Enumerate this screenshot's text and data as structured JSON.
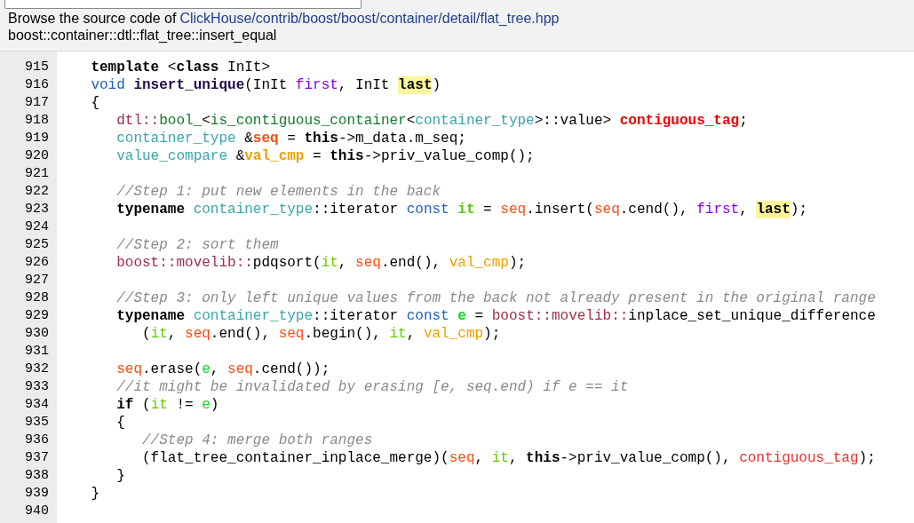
{
  "header": {
    "lead": "Browse the source code of",
    "path": [
      {
        "text": "ClickHouse"
      },
      {
        "text": "/"
      },
      {
        "text": "contrib"
      },
      {
        "text": "/"
      },
      {
        "text": "boost"
      },
      {
        "text": "/"
      },
      {
        "text": "boost"
      },
      {
        "text": "/"
      },
      {
        "text": "container"
      },
      {
        "text": "/"
      },
      {
        "text": "detail"
      },
      {
        "text": "/"
      },
      {
        "text": "flat_tree.hpp"
      }
    ],
    "symbol": "boost::container::dtl::flat_tree::insert_equal"
  },
  "lines": [
    {
      "number": "915",
      "tokens": [
        {
          "text": "    template",
          "kind": "keyword"
        },
        {
          "text": " <",
          "kind": "plain"
        },
        {
          "text": "class",
          "kind": "keyword"
        },
        {
          "text": " InIt>",
          "kind": "plain"
        }
      ]
    },
    {
      "number": "916",
      "tokens": [
        {
          "text": "    void",
          "kind": "type"
        },
        {
          "text": " insert_unique",
          "kind": "func"
        },
        {
          "text": "(InIt ",
          "kind": "plain"
        },
        {
          "text": "first",
          "kind": "param"
        },
        {
          "text": ", InIt ",
          "kind": "plain"
        },
        {
          "text": "last",
          "kind": "param-marked"
        },
        {
          "text": ")",
          "kind": "plain"
        }
      ]
    },
    {
      "number": "917",
      "tokens": [
        {
          "text": "    {",
          "kind": "plain"
        }
      ]
    },
    {
      "number": "918",
      "tokens": [
        {
          "text": "       dtl::",
          "kind": "ns"
        },
        {
          "text": "bool_",
          "kind": "tmpl"
        },
        {
          "text": "<",
          "kind": "plain"
        },
        {
          "text": "is_contiguous_container",
          "kind": "tmpl"
        },
        {
          "text": "<",
          "kind": "plain"
        },
        {
          "text": "container_type",
          "kind": "typedef"
        },
        {
          "text": ">::value> ",
          "kind": "plain"
        },
        {
          "text": "contiguous_tag",
          "kind": "tag"
        },
        {
          "text": ";",
          "kind": "plain"
        }
      ]
    },
    {
      "number": "919",
      "tokens": [
        {
          "text": "       container_type",
          "kind": "typedef"
        },
        {
          "text": " &",
          "kind": "plain"
        },
        {
          "text": "seq",
          "kind": "local-decl"
        },
        {
          "text": " = ",
          "kind": "plain"
        },
        {
          "text": "this",
          "kind": "keyword"
        },
        {
          "text": "->m_data.m_seq;",
          "kind": "plain"
        }
      ]
    },
    {
      "number": "920",
      "tokens": [
        {
          "text": "       value_compare",
          "kind": "typedef"
        },
        {
          "text": " &",
          "kind": "plain"
        },
        {
          "text": "val_cmp",
          "kind": "cmp-decl"
        },
        {
          "text": " = ",
          "kind": "plain"
        },
        {
          "text": "this",
          "kind": "keyword"
        },
        {
          "text": "->priv_value_comp();",
          "kind": "plain"
        }
      ]
    },
    {
      "number": "921"
    },
    {
      "number": "922",
      "tokens": [
        {
          "text": "       //Step 1: put new elements in the back",
          "kind": "comment"
        }
      ]
    },
    {
      "number": "923",
      "tokens": [
        {
          "text": "       typename",
          "kind": "keyword"
        },
        {
          "text": " container_type",
          "kind": "typedef"
        },
        {
          "text": "::iterator ",
          "kind": "plain"
        },
        {
          "text": "const",
          "kind": "type"
        },
        {
          "text": " it",
          "kind": "iter-decl"
        },
        {
          "text": " = ",
          "kind": "plain"
        },
        {
          "text": "seq",
          "kind": "local"
        },
        {
          "text": ".insert(",
          "kind": "plain"
        },
        {
          "text": "seq",
          "kind": "local"
        },
        {
          "text": ".cend(), ",
          "kind": "plain"
        },
        {
          "text": "first",
          "kind": "param"
        },
        {
          "text": ", ",
          "kind": "plain"
        },
        {
          "text": "last",
          "kind": "param-marked"
        },
        {
          "text": ");",
          "kind": "plain"
        }
      ]
    },
    {
      "number": "924"
    },
    {
      "number": "925",
      "tokens": [
        {
          "text": "       //Step 2: sort them",
          "kind": "comment"
        }
      ]
    },
    {
      "number": "926",
      "tokens": [
        {
          "text": "       boost::movelib::",
          "kind": "ns"
        },
        {
          "text": "pdqsort(",
          "kind": "plain"
        },
        {
          "text": "it",
          "kind": "iter"
        },
        {
          "text": ", ",
          "kind": "plain"
        },
        {
          "text": "seq",
          "kind": "local"
        },
        {
          "text": ".end(), ",
          "kind": "plain"
        },
        {
          "text": "val_cmp",
          "kind": "cmp"
        },
        {
          "text": ");",
          "kind": "plain"
        }
      ]
    },
    {
      "number": "927"
    },
    {
      "number": "928",
      "tokens": [
        {
          "text": "       //Step 3: only left unique values from the back not already present in the original range",
          "kind": "comment"
        }
      ]
    },
    {
      "number": "929",
      "tokens": [
        {
          "text": "       typename",
          "kind": "keyword"
        },
        {
          "text": " container_type",
          "kind": "typedef"
        },
        {
          "text": "::iterator ",
          "kind": "plain"
        },
        {
          "text": "const",
          "kind": "type"
        },
        {
          "text": " e",
          "kind": "e-decl"
        },
        {
          "text": " = ",
          "kind": "plain"
        },
        {
          "text": "boost::movelib::",
          "kind": "ns"
        },
        {
          "text": "inplace_set_unique_difference",
          "kind": "plain"
        }
      ]
    },
    {
      "number": "930",
      "tokens": [
        {
          "text": "          (",
          "kind": "plain"
        },
        {
          "text": "it",
          "kind": "iter"
        },
        {
          "text": ", ",
          "kind": "plain"
        },
        {
          "text": "seq",
          "kind": "local"
        },
        {
          "text": ".end(), ",
          "kind": "plain"
        },
        {
          "text": "seq",
          "kind": "local"
        },
        {
          "text": ".begin(), ",
          "kind": "plain"
        },
        {
          "text": "it",
          "kind": "iter"
        },
        {
          "text": ", ",
          "kind": "plain"
        },
        {
          "text": "val_cmp",
          "kind": "cmp"
        },
        {
          "text": ");",
          "kind": "plain"
        }
      ]
    },
    {
      "number": "931"
    },
    {
      "number": "932",
      "tokens": [
        {
          "text": "       seq",
          "kind": "local"
        },
        {
          "text": ".erase(",
          "kind": "plain"
        },
        {
          "text": "e",
          "kind": "e"
        },
        {
          "text": ", ",
          "kind": "plain"
        },
        {
          "text": "seq",
          "kind": "local"
        },
        {
          "text": ".cend());",
          "kind": "plain"
        }
      ]
    },
    {
      "number": "933",
      "tokens": [
        {
          "text": "       //it might be invalidated by erasing [e, seq.end) if e == it",
          "kind": "comment"
        }
      ]
    },
    {
      "number": "934",
      "tokens": [
        {
          "text": "       if",
          "kind": "keyword"
        },
        {
          "text": " (",
          "kind": "plain"
        },
        {
          "text": "it",
          "kind": "iter"
        },
        {
          "text": " != ",
          "kind": "plain"
        },
        {
          "text": "e",
          "kind": "e"
        },
        {
          "text": ")",
          "kind": "plain"
        }
      ]
    },
    {
      "number": "935",
      "tokens": [
        {
          "text": "       {",
          "kind": "plain"
        }
      ]
    },
    {
      "number": "936",
      "tokens": [
        {
          "text": "          //Step 4: merge both ranges",
          "kind": "comment"
        }
      ]
    },
    {
      "number": "937",
      "tokens": [
        {
          "text": "          (flat_tree_container_inplace_merge)(",
          "kind": "plain"
        },
        {
          "text": "seq",
          "kind": "local"
        },
        {
          "text": ", ",
          "kind": "plain"
        },
        {
          "text": "it",
          "kind": "iter"
        },
        {
          "text": ", ",
          "kind": "plain"
        },
        {
          "text": "this",
          "kind": "keyword"
        },
        {
          "text": "->priv_value_comp(), ",
          "kind": "plain"
        },
        {
          "text": "contiguous_tag",
          "kind": "tag-ref"
        },
        {
          "text": ");",
          "kind": "plain"
        }
      ]
    },
    {
      "number": "938",
      "tokens": [
        {
          "text": "       }",
          "kind": "plain"
        }
      ]
    },
    {
      "number": "939",
      "tokens": [
        {
          "text": "    }",
          "kind": "plain"
        }
      ]
    },
    {
      "number": "940"
    }
  ]
}
